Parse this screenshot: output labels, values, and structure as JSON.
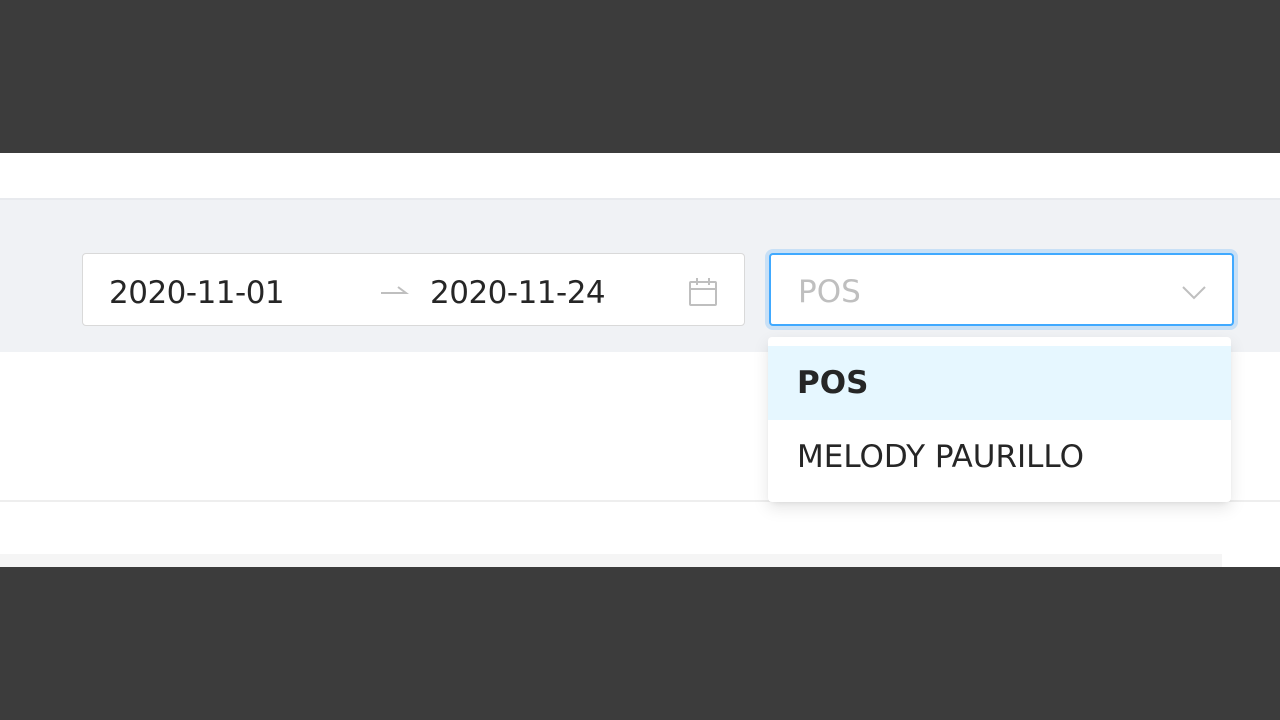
{
  "date_range": {
    "start": "2020-11-01",
    "end": "2020-11-24",
    "arrow_icon": "arrow-right-icon",
    "calendar_icon": "calendar-icon"
  },
  "select": {
    "placeholder": "POS",
    "chevron_icon": "chevron-down-icon",
    "accent_color": "#40a9ff"
  },
  "dropdown": {
    "options": [
      {
        "label": "POS",
        "selected": true
      },
      {
        "label": "MELODY PAURILLO",
        "selected": false
      }
    ],
    "selected_bg": "#e6f7ff"
  }
}
